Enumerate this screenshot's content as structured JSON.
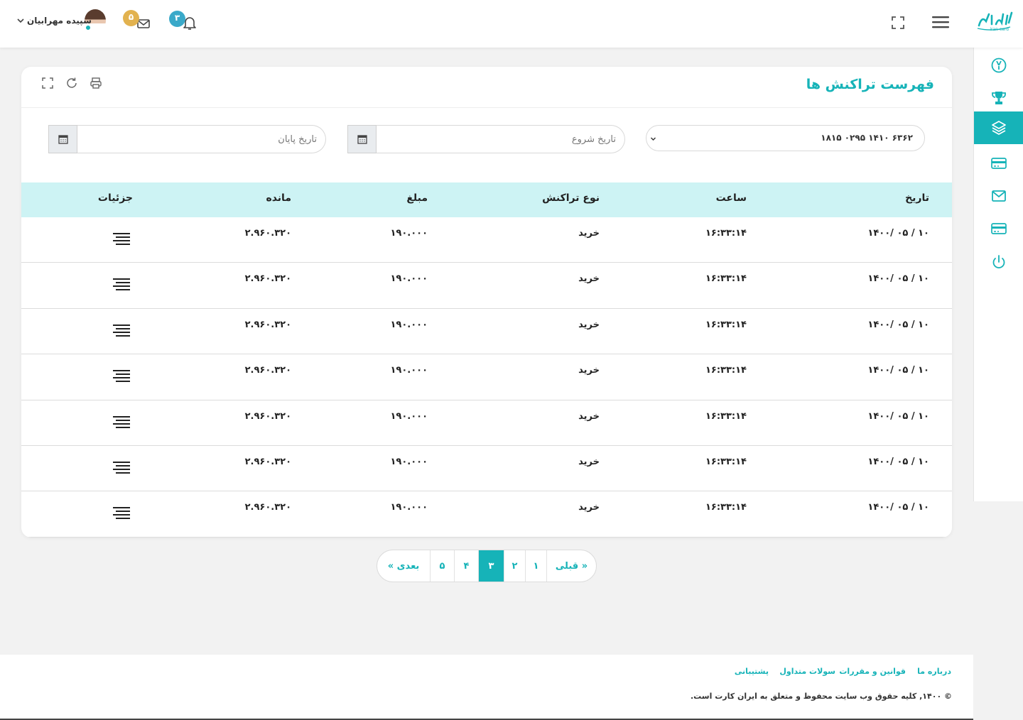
{
  "header": {
    "logo_text": "ایران کارت",
    "logo_sub": "iran card",
    "bell_count": "۳",
    "mail_count": "۵",
    "user_name": "سپیده مهرابیان"
  },
  "sidebar": {
    "items": [
      {
        "icon": "dashboard-icon"
      },
      {
        "icon": "trophy-icon"
      },
      {
        "icon": "layers-icon",
        "active": true
      },
      {
        "icon": "credit-card-icon"
      },
      {
        "icon": "mail-icon"
      },
      {
        "icon": "credit-card-icon"
      },
      {
        "icon": "power-icon"
      }
    ]
  },
  "card": {
    "title": "فهرست تراکنش ها",
    "card_select_value": "۶۳۶۲ ۱۴۱۰ ۰۲۹۵ ۱۸۱۵",
    "start_date_placeholder": "تاریخ شروع",
    "end_date_placeholder": "تاریخ پایان"
  },
  "table": {
    "headers": {
      "date": "تاریخ",
      "time": "ساعت",
      "type": "نوع تراکنش",
      "amount": "مبلغ",
      "balance": "مانده",
      "details": "جزئیات"
    },
    "rows": [
      {
        "date": "۱۰ / ۰۵ /۱۴۰۰",
        "time": "۱۶:۳۳:۱۴",
        "type": "خرید",
        "amount": "۱۹۰.۰۰۰",
        "balance": "۲.۹۶۰.۳۲۰"
      },
      {
        "date": "۱۰ / ۰۵ /۱۴۰۰",
        "time": "۱۶:۳۳:۱۴",
        "type": "خرید",
        "amount": "۱۹۰.۰۰۰",
        "balance": "۲.۹۶۰.۳۲۰"
      },
      {
        "date": "۱۰ / ۰۵ /۱۴۰۰",
        "time": "۱۶:۳۳:۱۴",
        "type": "خرید",
        "amount": "۱۹۰.۰۰۰",
        "balance": "۲.۹۶۰.۳۲۰"
      },
      {
        "date": "۱۰ / ۰۵ /۱۴۰۰",
        "time": "۱۶:۳۳:۱۴",
        "type": "خرید",
        "amount": "۱۹۰.۰۰۰",
        "balance": "۲.۹۶۰.۳۲۰"
      },
      {
        "date": "۱۰ / ۰۵ /۱۴۰۰",
        "time": "۱۶:۳۳:۱۴",
        "type": "خرید",
        "amount": "۱۹۰.۰۰۰",
        "balance": "۲.۹۶۰.۳۲۰"
      },
      {
        "date": "۱۰ / ۰۵ /۱۴۰۰",
        "time": "۱۶:۳۳:۱۴",
        "type": "خرید",
        "amount": "۱۹۰.۰۰۰",
        "balance": "۲.۹۶۰.۳۲۰"
      },
      {
        "date": "۱۰ / ۰۵ /۱۴۰۰",
        "time": "۱۶:۳۳:۱۴",
        "type": "خرید",
        "amount": "۱۹۰.۰۰۰",
        "balance": "۲.۹۶۰.۳۲۰"
      }
    ]
  },
  "pagination": {
    "prev": "« قبلی",
    "pages": [
      "۱",
      "۲",
      "۳",
      "۴",
      "۵"
    ],
    "active_page": "۳",
    "next": "بعدی »"
  },
  "footer": {
    "links": [
      "درباره ما",
      "قوانین و مقررات",
      "سولات متداول",
      "پشتیبانی"
    ],
    "copyright": "© ۱۴۰۰, کلیه حقوق وب سایت محفوظ و متعلق به ایران کارت است."
  },
  "colors": {
    "accent": "#16b3b8",
    "table_header_bg": "#cdf3f4",
    "bell_badge": "#3aa9c9",
    "mail_badge": "#e2b24f"
  }
}
